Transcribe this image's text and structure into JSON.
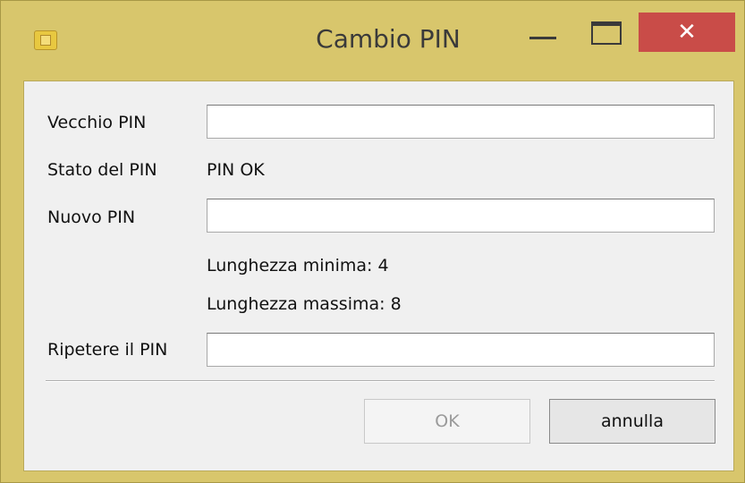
{
  "window": {
    "title": "Cambio PIN",
    "close_glyph": "✕",
    "icon": "smartcard-icon"
  },
  "form": {
    "old_pin_label": "Vecchio PIN",
    "old_pin_value": "",
    "pin_status_label": "Stato del PIN",
    "pin_status_value": "PIN OK",
    "new_pin_label": "Nuovo PIN",
    "new_pin_value": "",
    "min_length_text": "Lunghezza minima: 4",
    "max_length_text": "Lunghezza massima: 8",
    "repeat_pin_label": "Ripetere il PIN",
    "repeat_pin_value": ""
  },
  "buttons": {
    "ok_label": "OK",
    "ok_enabled": false,
    "cancel_label": "annulla"
  }
}
